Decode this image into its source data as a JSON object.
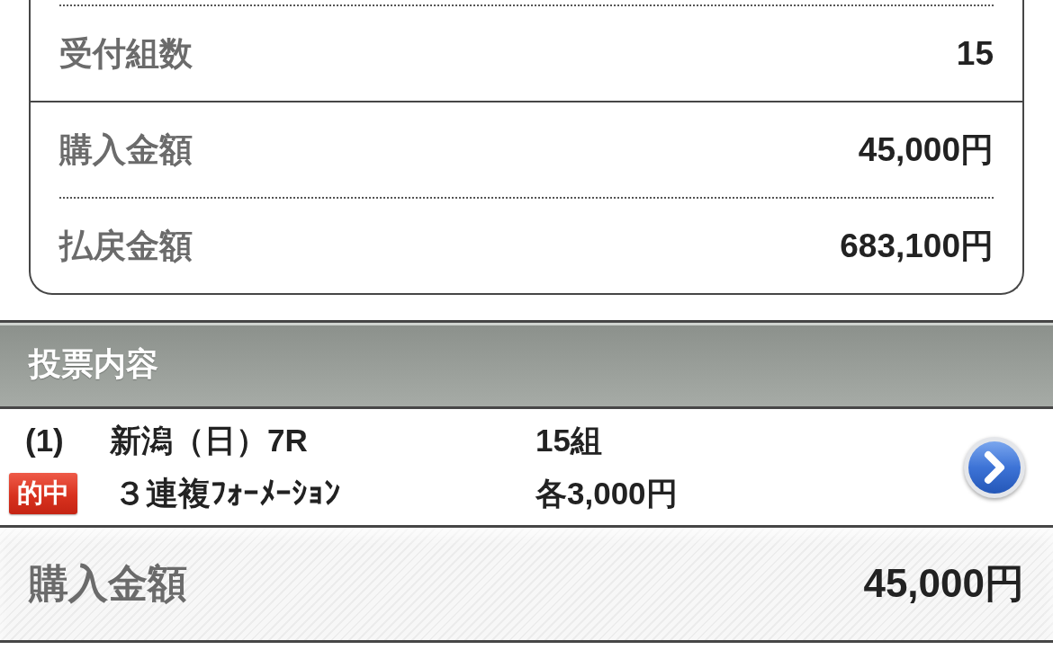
{
  "summary_card": {
    "groups": [
      {
        "rows": [
          {
            "label": "受付組数",
            "value": "15"
          }
        ]
      },
      {
        "rows": [
          {
            "label": "購入金額",
            "value": "45,000円"
          },
          {
            "label": "払戻金額",
            "value": "683,100円"
          }
        ]
      }
    ]
  },
  "bet_section": {
    "title": "投票内容",
    "bets": [
      {
        "number": "(1)",
        "venue": "新潟（日）7R",
        "badge": "的中",
        "bet_type": "３連複ﾌｫｰﾒｰｼｮﾝ",
        "count": "15組",
        "stake": "各3,000円"
      }
    ]
  },
  "footer": {
    "label": "購入金額",
    "value": "45,000円"
  }
}
